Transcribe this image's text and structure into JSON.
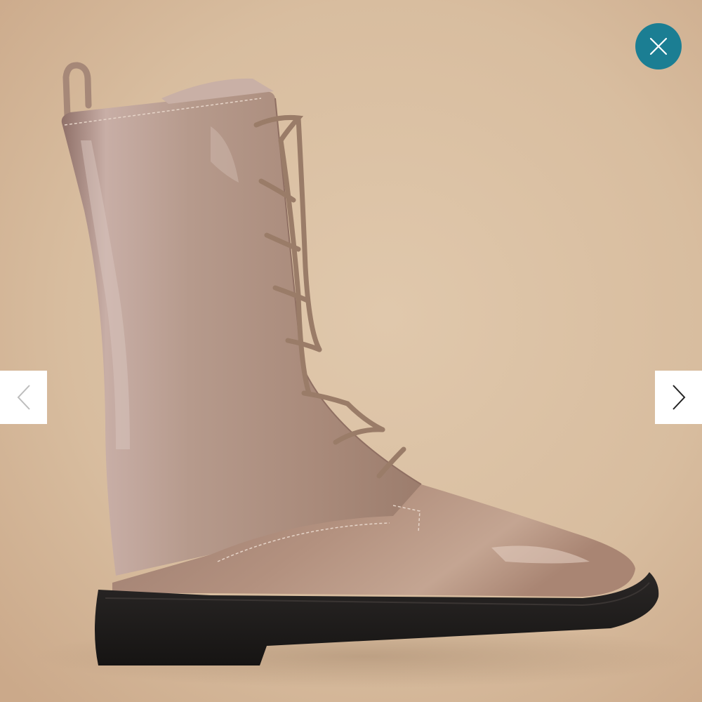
{
  "viewer": {
    "image_alt": "",
    "background_color": "#d9bfa2",
    "boot_color": "#b18f7e",
    "sole_color": "#1c1a19"
  },
  "controls": {
    "close_color": "#1b7e93",
    "close_icon": "close-icon",
    "prev_icon": "chevron-left-icon",
    "next_icon": "chevron-right-icon",
    "nav_bg": "#ffffff",
    "prev_icon_color": "#bdbdbd",
    "next_icon_color": "#222222"
  }
}
